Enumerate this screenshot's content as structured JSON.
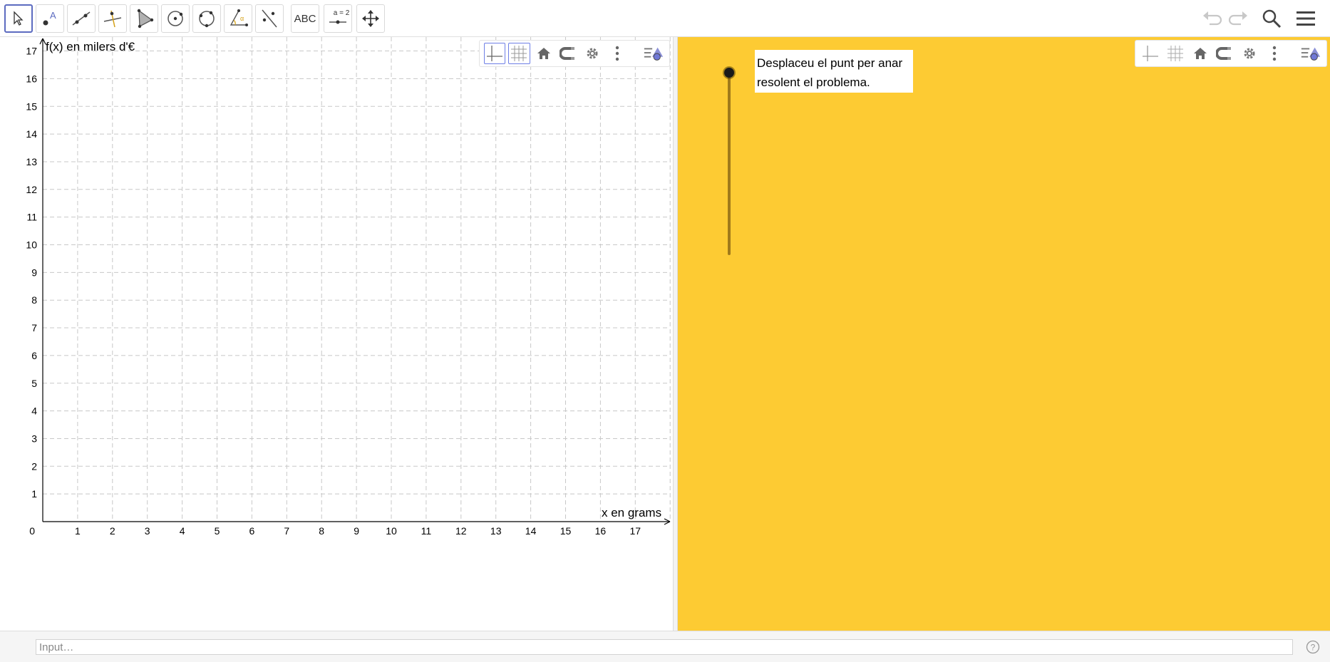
{
  "toolbar": {
    "tools": [
      "move",
      "point",
      "line",
      "perpendicular-line",
      "polygon",
      "circle-center",
      "circle-three-points",
      "angle",
      "reflect",
      "text",
      "slider",
      "move-graphics-view"
    ],
    "text_tool_label": "ABC",
    "slider_tool_label": "a = 2",
    "active_tool": "move"
  },
  "graphics1": {
    "x_axis_label": "x en grams",
    "y_axis_label": "f(x) en milers d'€",
    "origin_label": "0",
    "x_ticks": [
      "1",
      "2",
      "3",
      "4",
      "5",
      "6",
      "7",
      "8",
      "9",
      "10",
      "11",
      "12",
      "13",
      "14",
      "15",
      "16",
      "17"
    ],
    "y_ticks": [
      "1",
      "2",
      "3",
      "4",
      "5",
      "6",
      "7",
      "8",
      "9",
      "10",
      "11",
      "12",
      "13",
      "14",
      "15",
      "16",
      "17"
    ],
    "x_range": [
      -0.2,
      18.2
    ],
    "y_range": [
      -0.3,
      17.3
    ],
    "grid": true
  },
  "graphics2": {
    "background_color": "#fdcb33",
    "instruction_line1": "Desplaceu el punt per anar",
    "instruction_line2": "resolent el problema.",
    "slider_value": 1.0
  },
  "inputbar": {
    "placeholder": "Input…"
  }
}
